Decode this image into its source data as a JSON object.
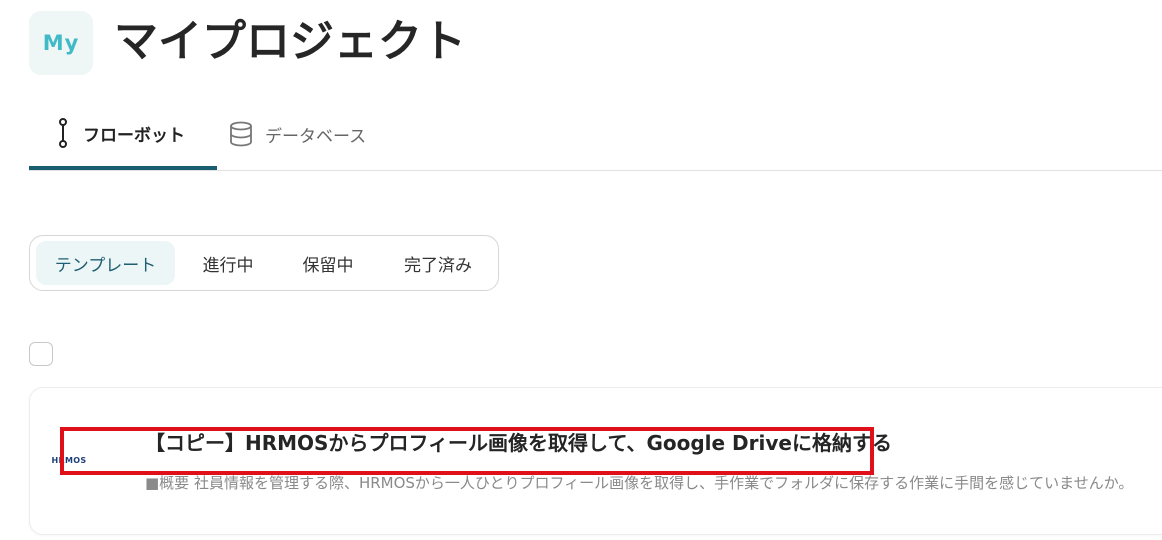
{
  "header": {
    "avatar_text": "My",
    "title": "マイプロジェクト"
  },
  "tabs": [
    {
      "label": "フローボット",
      "icon": "flow-icon",
      "active": true
    },
    {
      "label": "データベース",
      "icon": "database-icon",
      "active": false
    }
  ],
  "filters": [
    {
      "label": "テンプレート",
      "selected": true
    },
    {
      "label": "進行中",
      "selected": false
    },
    {
      "label": "保留中",
      "selected": false
    },
    {
      "label": "完了済み",
      "selected": false
    }
  ],
  "flow_card": {
    "logo_text": "HRMOS",
    "title": "【コピー】HRMOSからプロフィール画像を取得して、Google Driveに格納する",
    "description": "■概要 社員情報を管理する際、HRMOSから一人ひとりプロフィール画像を取得し、手作業でフォルダに保存する作業に手間を感じていませんか。"
  },
  "colors": {
    "accent": "#1a5d6e",
    "highlight": "#e0101b",
    "avatar_text": "#41b9c6"
  }
}
